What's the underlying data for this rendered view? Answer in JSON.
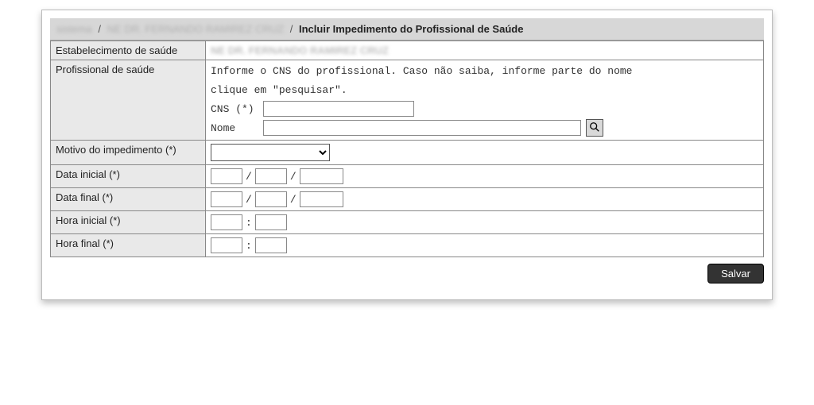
{
  "breadcrumb": {
    "part1": "sistema",
    "part2": "NE DR. FERNANDO RAMIREZ CRUZ",
    "current": "Incluir Impedimento do Profissional de Saúde"
  },
  "rows": {
    "estabelecimento_label": "Estabelecimento de saúde",
    "estabelecimento_value": "NE DR. FERNANDO RAMIREZ CRUZ",
    "profissional_label": "Profissional de saúde",
    "profissional_help1": "Informe o CNS do profissional. Caso não saiba, informe parte do nome",
    "profissional_help2": "clique em \"pesquisar\".",
    "cns_label": "CNS (*)",
    "nome_label": "Nome",
    "motivo_label": "Motivo do impedimento (*)",
    "data_inicial_label": "Data inicial (*)",
    "data_final_label": "Data final (*)",
    "hora_inicial_label": "Hora inicial (*)",
    "hora_final_label": "Hora final (*)"
  },
  "buttons": {
    "save": "Salvar"
  },
  "separators": {
    "slash": "/",
    "colon": ":"
  }
}
